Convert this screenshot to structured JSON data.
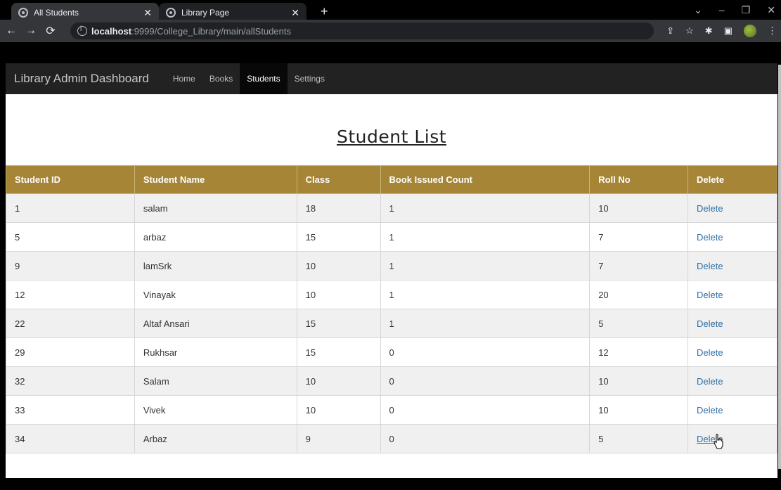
{
  "browser": {
    "tabs": [
      {
        "title": "All Students",
        "active": true
      },
      {
        "title": "Library Page",
        "active": false
      }
    ],
    "url_host": "localhost",
    "url_path": ":9999/College_Library/main/allStudents"
  },
  "navbar": {
    "brand": "Library Admin Dashboard",
    "items": [
      "Home",
      "Books",
      "Students",
      "Settings"
    ],
    "active": "Students"
  },
  "page": {
    "title": "Student List"
  },
  "table": {
    "headers": [
      "Student ID",
      "Student Name",
      "Class",
      "Book Issued Count",
      "Roll No",
      "Delete"
    ],
    "rows": [
      [
        "1",
        "salam",
        "18",
        "1",
        "10",
        "Delete"
      ],
      [
        "5",
        "arbaz",
        "15",
        "1",
        "7",
        "Delete"
      ],
      [
        "9",
        "lamSrk",
        "10",
        "1",
        "7",
        "Delete"
      ],
      [
        "12",
        "Vinayak",
        "10",
        "1",
        "20",
        "Delete"
      ],
      [
        "22",
        "Altaf Ansari",
        "15",
        "1",
        "5",
        "Delete"
      ],
      [
        "29",
        "Rukhsar",
        "15",
        "0",
        "12",
        "Delete"
      ],
      [
        "32",
        "Salam",
        "10",
        "0",
        "10",
        "Delete"
      ],
      [
        "33",
        "Vivek",
        "10",
        "0",
        "10",
        "Delete"
      ],
      [
        "34",
        "Arbaz",
        "9",
        "0",
        "5",
        "Delete"
      ]
    ]
  },
  "colors": {
    "header_bg": "#a68537",
    "navbar_bg": "#222222",
    "link": "#2e6da4"
  }
}
